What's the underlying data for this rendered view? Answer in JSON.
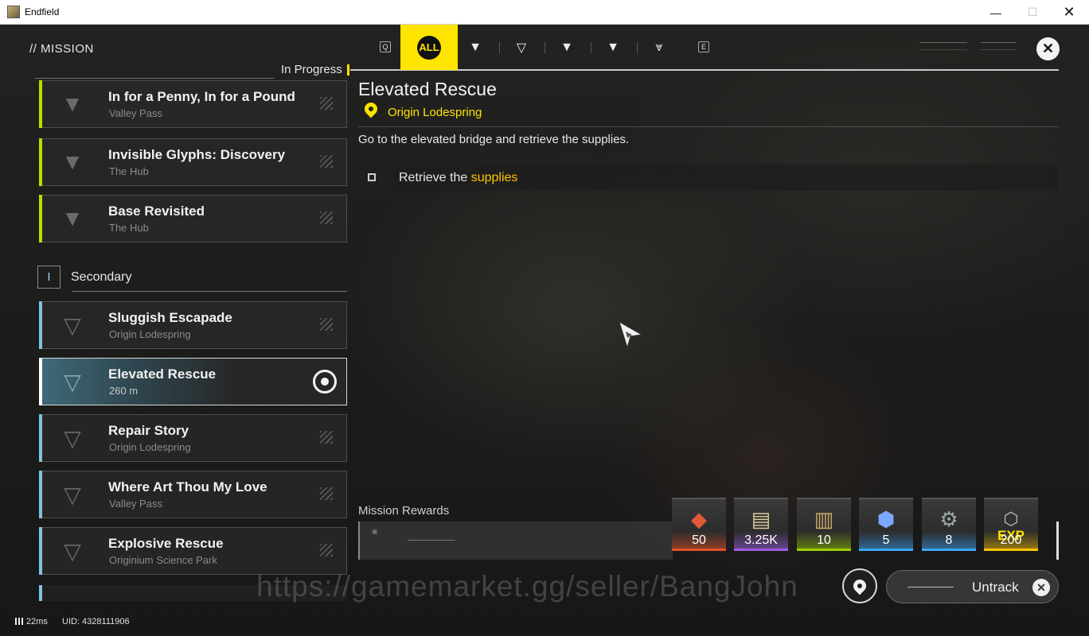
{
  "window": {
    "title": "Endfield",
    "min": "—",
    "max": "☐",
    "close": "✕"
  },
  "header": {
    "section": "// MISSION",
    "list_heading": "In Progress",
    "tabs": [
      {
        "key": "Q",
        "icon": "q-key-icon"
      },
      {
        "label": "ALL",
        "active": true
      },
      {
        "icon": "main-mission-icon"
      },
      {
        "icon": "side-mission-icon"
      },
      {
        "icon": "exploration-mission-icon"
      },
      {
        "icon": "event-mission-icon"
      },
      {
        "icon": "daily-mission-icon"
      },
      {
        "key": "E",
        "icon": "e-key-icon"
      }
    ],
    "accent": "#ffe400"
  },
  "missions": {
    "in_progress": [
      {
        "name": "In for a Penny, In for a Pound",
        "location": "Valley Pass",
        "color": "#b7e000"
      },
      {
        "name": "Invisible Glyphs: Discovery",
        "location": "The Hub",
        "color": "#b7e000"
      },
      {
        "name": "Base Revisited",
        "location": "The Hub",
        "color": "#b7e000"
      }
    ],
    "secondary_index": "I",
    "secondary_label": "Secondary",
    "secondary": [
      {
        "name": "Sluggish Escapade",
        "location": "Origin Lodespring",
        "color": "#7fc6e0"
      },
      {
        "name": "Elevated Rescue",
        "location": "260 m",
        "color": "#ffffff",
        "active": true
      },
      {
        "name": "Repair Story",
        "location": "Origin Lodespring",
        "color": "#7fc6e0"
      },
      {
        "name": "Where Art Thou My Love",
        "location": "Valley Pass",
        "color": "#7fc6e0"
      },
      {
        "name": "Explosive Rescue",
        "location": "Originium Science Park",
        "color": "#7fc6e0"
      }
    ]
  },
  "detail": {
    "title": "Elevated Rescue",
    "location": "Origin Lodespring",
    "description": "Go to the elevated bridge and retrieve the supplies.",
    "objective_prefix": "Retrieve the ",
    "objective_highlight": "supplies"
  },
  "rewards": {
    "label": "Mission Rewards",
    "items": [
      {
        "icon": "origeometry-icon",
        "qty": "50",
        "rarity": "#e0522a"
      },
      {
        "icon": "credit-tickets-icon",
        "qty": "3.25K",
        "rarity": "#9b5ce0"
      },
      {
        "icon": "exp-record-icon",
        "qty": "10",
        "rarity": "#9fd000"
      },
      {
        "icon": "crystal-material-icon",
        "qty": "5",
        "rarity": "#3aa8ff"
      },
      {
        "icon": "device-component-icon",
        "qty": "8",
        "rarity": "#3aa8ff"
      },
      {
        "icon": "exp-icon",
        "qty": "200",
        "rarity": "#ffc400",
        "label": "EXP"
      }
    ]
  },
  "controls": {
    "untrack_label": "Untrack"
  },
  "watermark": "https://gamemarket.gg/seller/BangJohn",
  "status": {
    "ping": "22ms",
    "uid": "UID: 4328111906"
  }
}
